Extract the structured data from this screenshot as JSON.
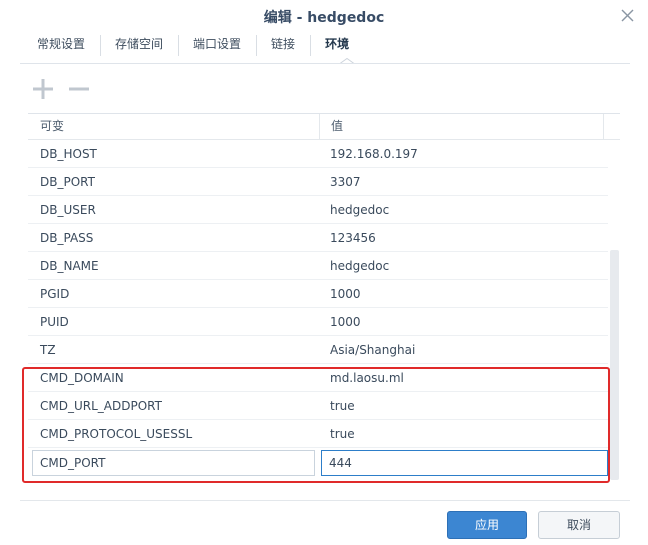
{
  "window": {
    "title": "编辑 - hedgedoc"
  },
  "tabs": [
    {
      "label": "常规设置",
      "active": false
    },
    {
      "label": "存储空间",
      "active": false
    },
    {
      "label": "端口设置",
      "active": false
    },
    {
      "label": "链接",
      "active": false
    },
    {
      "label": "环境",
      "active": true
    }
  ],
  "toolbar": {
    "add_icon": "plus-icon",
    "remove_icon": "minus-icon"
  },
  "grid": {
    "columns": [
      "可变",
      "值"
    ],
    "rows": [
      {
        "key": "DB_HOST",
        "value": "192.168.0.197"
      },
      {
        "key": "DB_PORT",
        "value": "3307"
      },
      {
        "key": "DB_USER",
        "value": "hedgedoc"
      },
      {
        "key": "DB_PASS",
        "value": "123456"
      },
      {
        "key": "DB_NAME",
        "value": "hedgedoc"
      },
      {
        "key": "PGID",
        "value": "1000"
      },
      {
        "key": "PUID",
        "value": "1000"
      },
      {
        "key": "TZ",
        "value": "Asia/Shanghai"
      },
      {
        "key": "CMD_DOMAIN",
        "value": "md.laosu.ml"
      },
      {
        "key": "CMD_URL_ADDPORT",
        "value": "true"
      },
      {
        "key": "CMD_PROTOCOL_USESSL",
        "value": "true"
      }
    ],
    "editing_row": {
      "key": "CMD_PORT",
      "value": "444"
    }
  },
  "footer": {
    "apply_label": "应用",
    "cancel_label": "取消"
  },
  "colors": {
    "accent": "#3c86d2",
    "highlight": "#e02a2a"
  }
}
